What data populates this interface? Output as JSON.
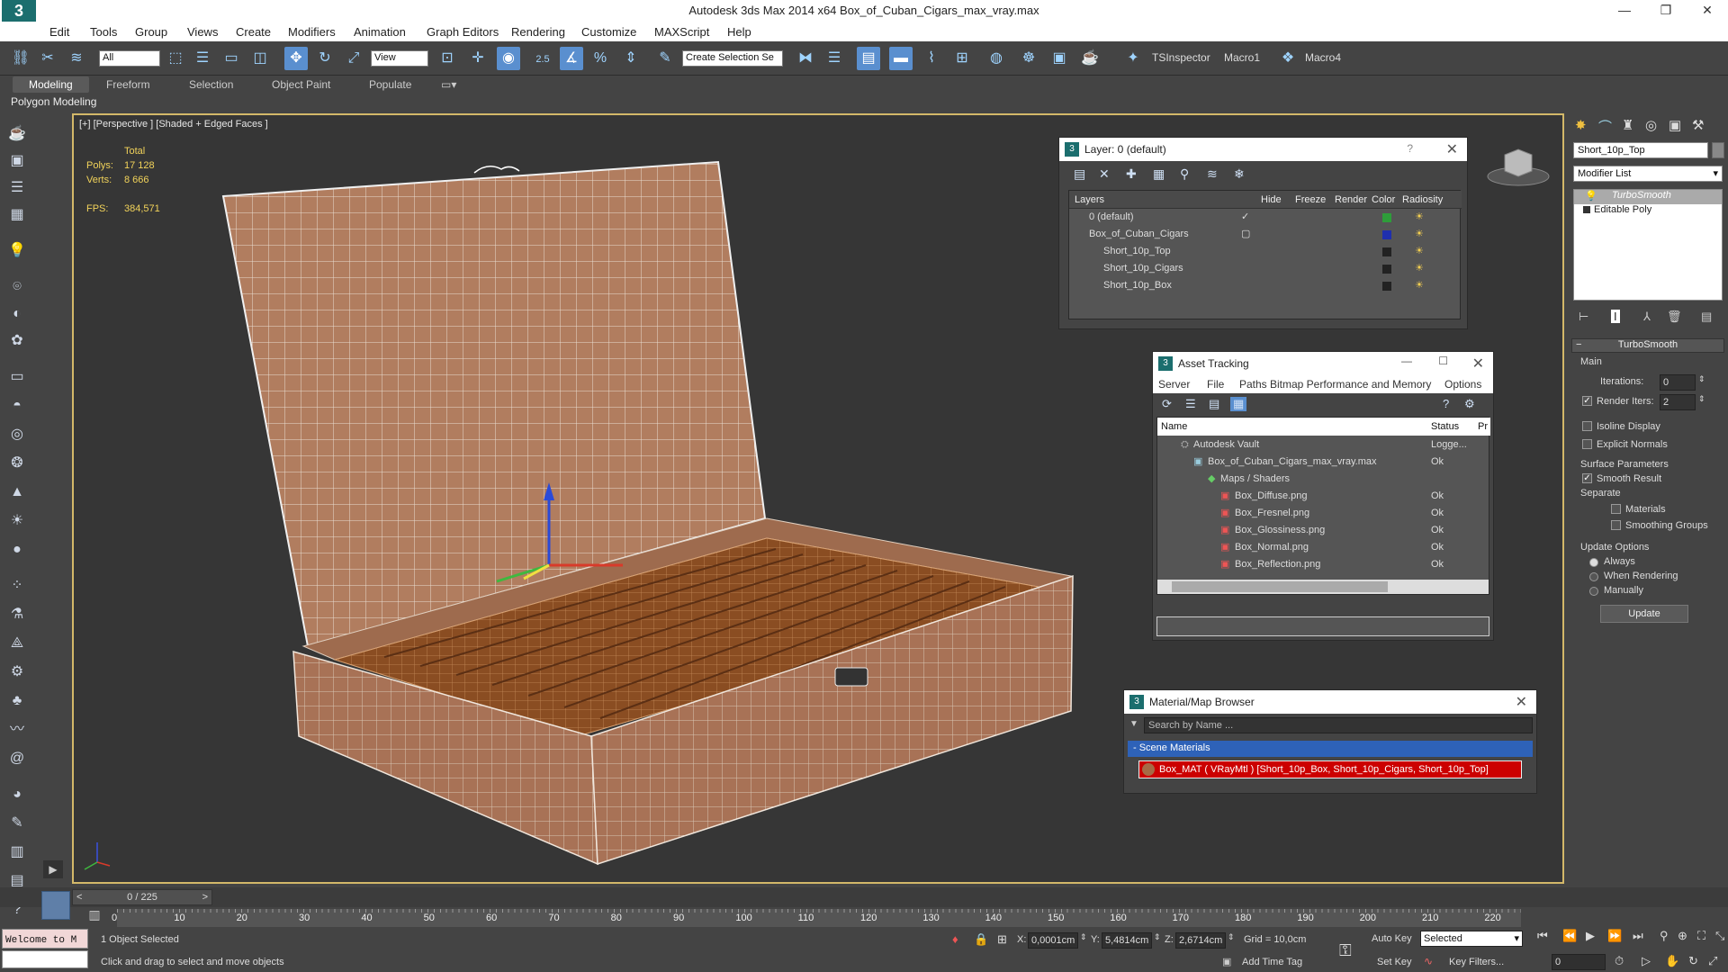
{
  "window": {
    "title": "Autodesk 3ds Max  2014 x64    Box_of_Cuban_Cigars_max_vray.max",
    "controls": [
      "—",
      "❐",
      "✕"
    ]
  },
  "menu": [
    "Edit",
    "Tools",
    "Group",
    "Views",
    "Create",
    "Modifiers",
    "Animation",
    "Graph Editors",
    "Rendering",
    "Customize",
    "MAXScript",
    "Help"
  ],
  "toolbar": {
    "selection_filter": "All",
    "ref_coord": "View",
    "angle_snap": "2.5",
    "named_selection_placeholder": "Create Selection Se",
    "tsinspector": "TSInspector",
    "macro1": "Macro1",
    "macro4": "Macro4"
  },
  "ribbon": {
    "tabs": [
      "Modeling",
      "Freeform",
      "Selection",
      "Object Paint",
      "Populate"
    ],
    "active": "Modeling",
    "subtitle": "Polygon Modeling"
  },
  "viewport": {
    "label": "[+] [Perspective ] [Shaded + Edged Faces ]",
    "stats": {
      "header": "Total",
      "polys_label": "Polys:",
      "polys": "17 128",
      "verts_label": "Verts:",
      "verts": "8 666",
      "fps_label": "FPS:",
      "fps": "384,571"
    },
    "colors": {
      "border": "#d3b869",
      "bg": "#363636",
      "wood": "#b17d5f",
      "cigar": "#8a4d22"
    }
  },
  "layer_panel": {
    "title": "Layer: 0 (default)",
    "help": "?",
    "columns": [
      "Layers",
      "Hide",
      "Freeze",
      "Render",
      "Color",
      "Radiosity"
    ],
    "rows": [
      {
        "name": "0 (default)",
        "color": "#2e9d3a",
        "check": "✓"
      },
      {
        "name": "Box_of_Cuban_Cigars",
        "color": "#1f2fae",
        "check": "▢"
      },
      {
        "name": "Short_10p_Top",
        "color": "#222222",
        "check": ""
      },
      {
        "name": "Short_10p_Cigars",
        "color": "#222222",
        "check": ""
      },
      {
        "name": "Short_10p_Box",
        "color": "#222222",
        "check": ""
      }
    ]
  },
  "asset_panel": {
    "title": "Asset Tracking",
    "menu": [
      "Server",
      "File",
      "Paths",
      "Bitmap Performance and Memory",
      "Options"
    ],
    "columns": [
      "Name",
      "Status",
      "Pr"
    ],
    "rows": [
      {
        "name": "Autodesk Vault",
        "status": "Logge..."
      },
      {
        "name": "Box_of_Cuban_Cigars_max_vray.max",
        "status": "Ok"
      },
      {
        "name": "Maps / Shaders",
        "status": ""
      },
      {
        "name": "Box_Diffuse.png",
        "status": "Ok"
      },
      {
        "name": "Box_Fresnel.png",
        "status": "Ok"
      },
      {
        "name": "Box_Glossiness.png",
        "status": "Ok"
      },
      {
        "name": "Box_Normal.png",
        "status": "Ok"
      },
      {
        "name": "Box_Reflection.png",
        "status": "Ok"
      }
    ]
  },
  "material_panel": {
    "title": "Material/Map Browser",
    "search_placeholder": "Search by Name ...",
    "section": "- Scene Materials",
    "item": "Box_MAT  ( VRayMtl )  [Short_10p_Box, Short_10p_Cigars, Short_10p_Top]"
  },
  "command_panel": {
    "object_name": "Short_10p_Top",
    "modifier_list": "Modifier List",
    "stack": [
      "TurboSmooth",
      "Editable Poly"
    ],
    "rollout": "TurboSmooth",
    "main": "Main",
    "iterations_label": "Iterations:",
    "iterations": "0",
    "render_iters_label": "Render Iters:",
    "render_iters": "2",
    "isoline": "Isoline Display",
    "explicit_normals": "Explicit Normals",
    "surface_params": "Surface Parameters",
    "smooth_result": "Smooth Result",
    "separate": "Separate",
    "materials": "Materials",
    "smoothing_groups": "Smoothing Groups",
    "update_options": "Update Options",
    "always": "Always",
    "when_rendering": "When Rendering",
    "manually": "Manually",
    "update_btn": "Update"
  },
  "timeline": {
    "frame": "0 / 225",
    "ticks": [
      "0",
      "10",
      "20",
      "30",
      "40",
      "50",
      "60",
      "70",
      "80",
      "90",
      "100",
      "110",
      "120",
      "130",
      "140",
      "150",
      "160",
      "170",
      "180",
      "190",
      "200",
      "210",
      "220"
    ]
  },
  "status": {
    "welcome": "Welcome to M",
    "selected": "1 Object Selected",
    "prompt": "Click and drag to select and move objects",
    "x_label": "X:",
    "x": "0,0001cm",
    "y_label": "Y:",
    "y": "5,4814cm",
    "z_label": "Z:",
    "z": "2,6714cm",
    "grid": "Grid = 10,0cm",
    "add_time_tag": "Add Time Tag",
    "auto_key": "Auto Key",
    "set_key": "Set Key",
    "selected_dropdown": "Selected",
    "key_filters": "Key Filters...",
    "frame_value": "0"
  }
}
